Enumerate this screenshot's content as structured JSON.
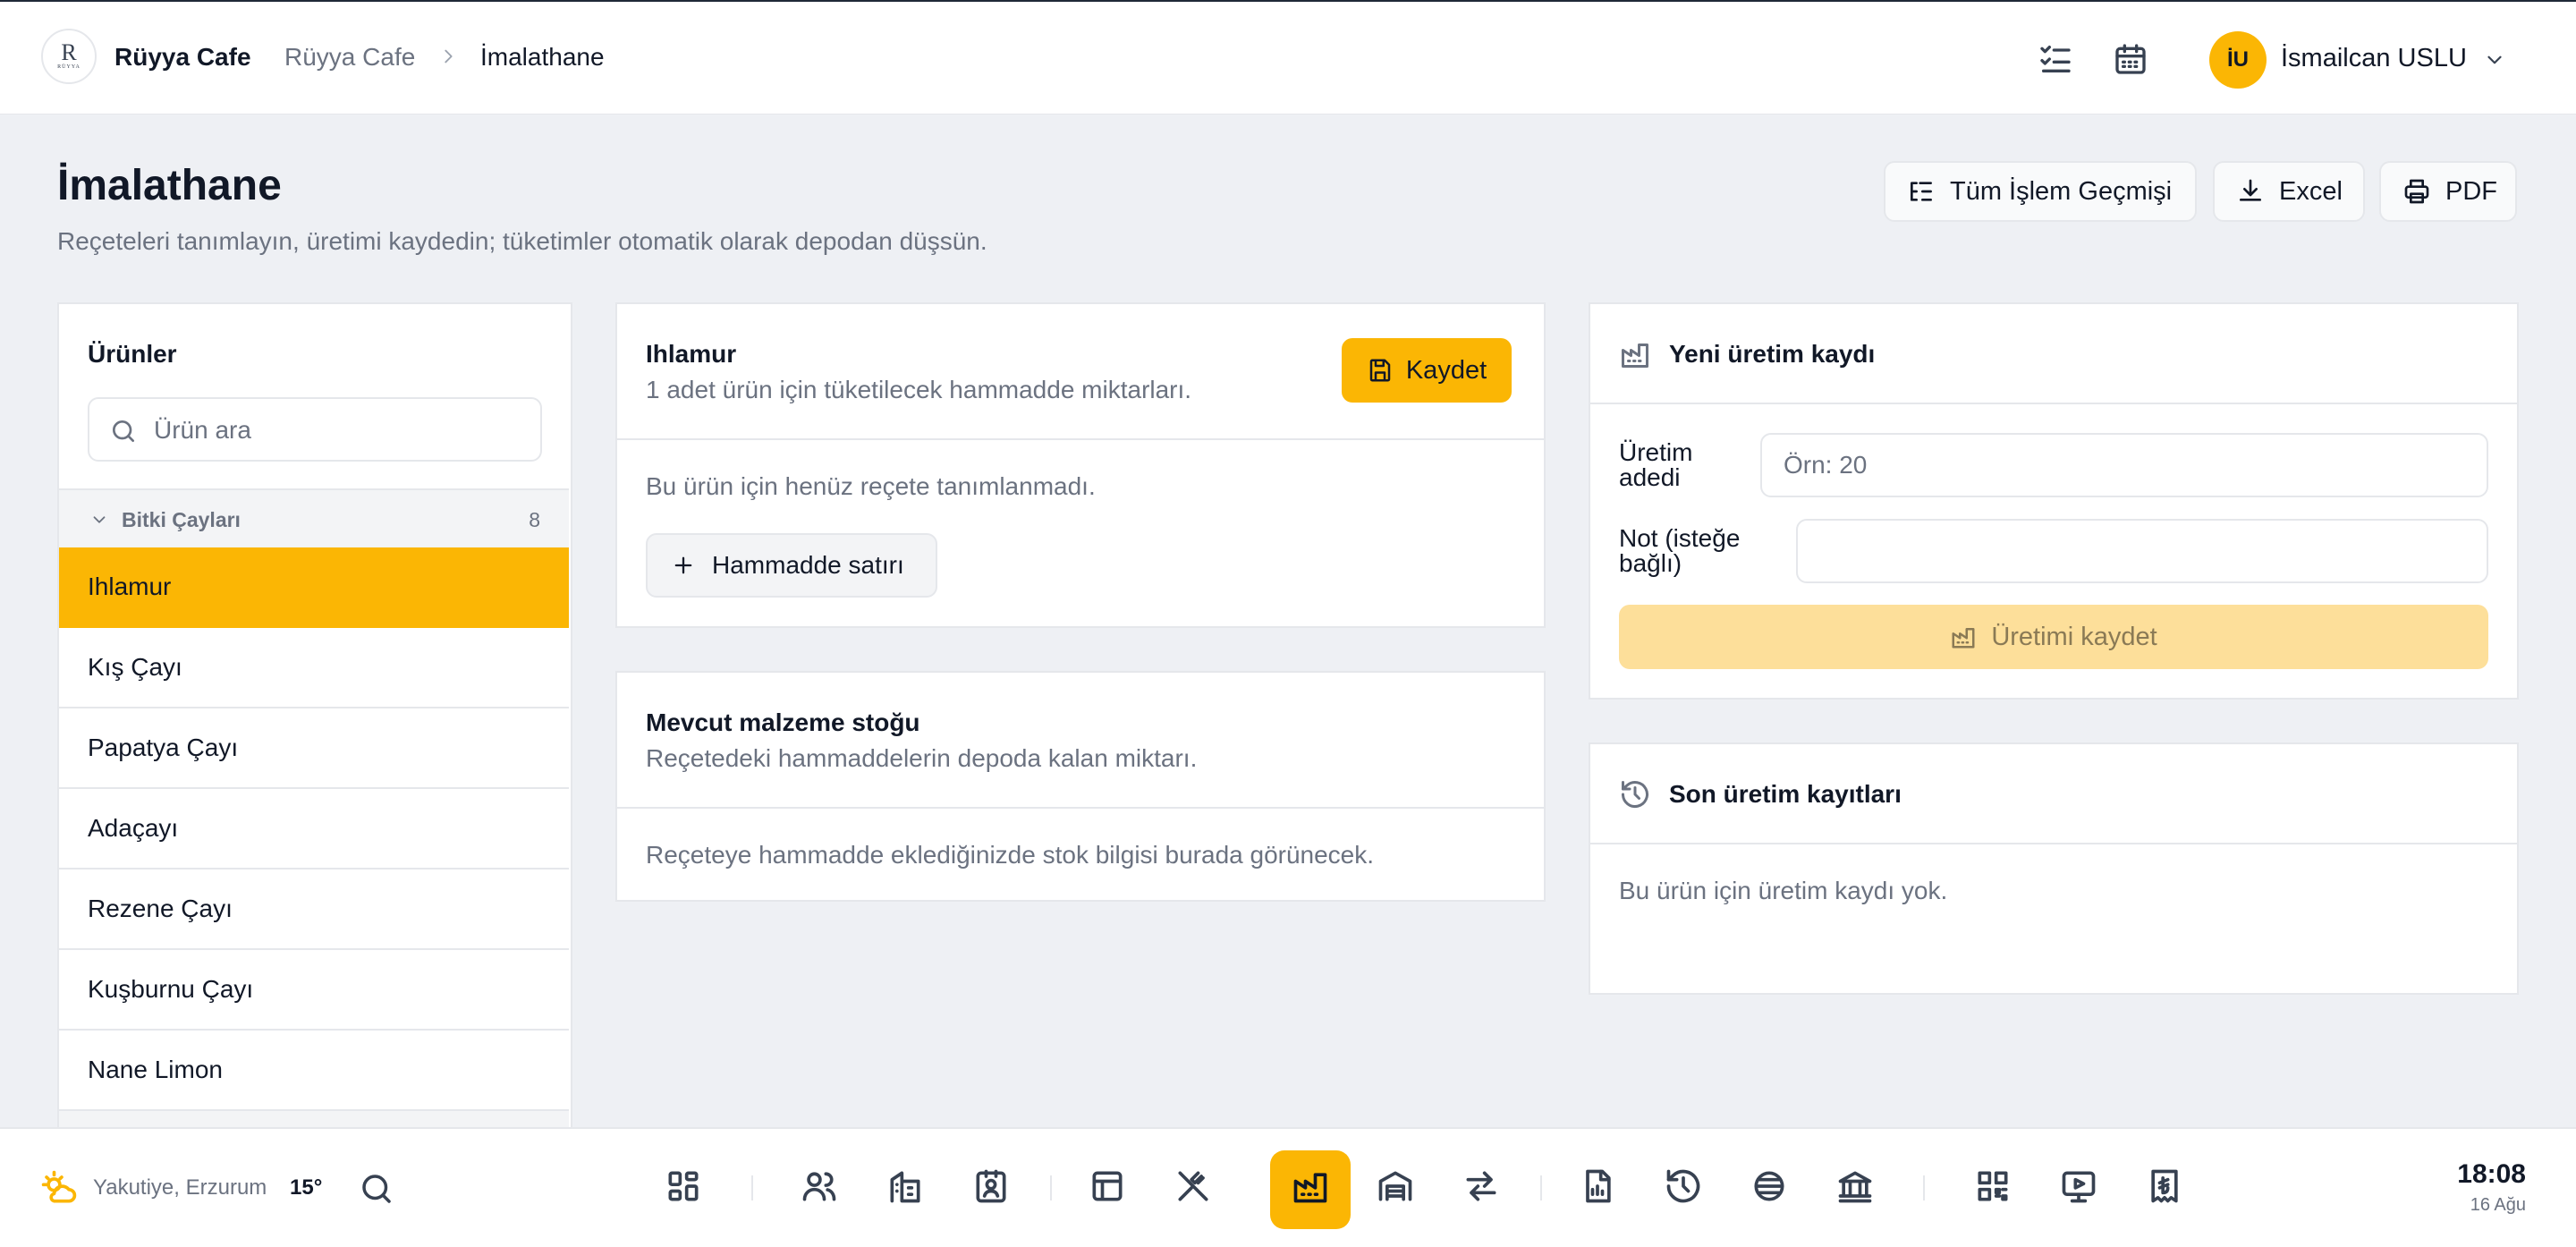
{
  "header": {
    "brand": "Rüyya Cafe",
    "breadcrumb": [
      "Rüyya Cafe",
      "İmalathane"
    ],
    "user": {
      "initials": "İU",
      "name": "İsmailcan USLU"
    }
  },
  "page": {
    "title": "İmalathane",
    "subtitle": "Reçeteleri tanımlayın, üretimi kaydedin; tüketimler otomatik olarak depodan düşsün.",
    "actions": {
      "history": "Tüm İşlem Geçmişi",
      "excel": "Excel",
      "pdf": "PDF"
    }
  },
  "products": {
    "title": "Ürünler",
    "search_placeholder": "Ürün ara",
    "category": {
      "name": "Bitki Çayları",
      "count": "8"
    },
    "items": [
      "Ihlamur",
      "Kış Çayı",
      "Papatya Çayı",
      "Adaçayı",
      "Rezene Çayı",
      "Kuşburnu Çayı",
      "Nane Limon"
    ]
  },
  "recipe": {
    "title": "Ihlamur",
    "subtitle": "1 adet ürün için tüketilecek hammadde miktarları.",
    "save_label": "Kaydet",
    "empty": "Bu ürün için henüz reçete tanımlanmadı.",
    "add_row_label": "Hammadde satırı"
  },
  "stock": {
    "title": "Mevcut malzeme stoğu",
    "subtitle": "Reçetedeki hammaddelerin depoda kalan miktarı.",
    "empty": "Reçeteye hammadde eklediğinizde stok bilgisi burada görünecek."
  },
  "production_form": {
    "title": "Yeni üretim kaydı",
    "qty_label_1": "Üretim",
    "qty_label_2": "adedi",
    "qty_placeholder": "Örn: 20",
    "note_label_1": "Not (isteğe",
    "note_label_2": "bağlı)",
    "submit_label": "Üretimi kaydet"
  },
  "recent": {
    "title": "Son üretim kayıtları",
    "empty": "Bu ürün için üretim kaydı yok."
  },
  "dock": {
    "location": "Yakutiye, Erzurum",
    "temperature": "15°",
    "time": "18:08",
    "date": "16 Ağu",
    "active_item": "production-icon"
  },
  "colors": {
    "accent": "#fbb604",
    "accent_disabled": "#fddf9a",
    "background": "#eef0f4"
  }
}
